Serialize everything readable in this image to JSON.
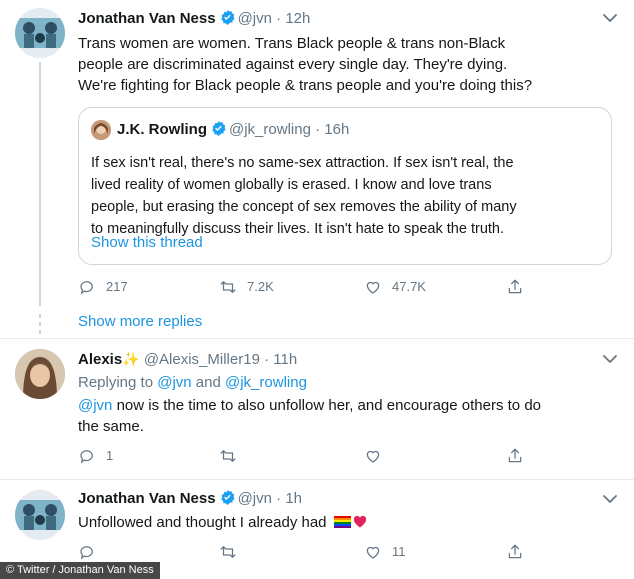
{
  "tweets": [
    {
      "name": "Jonathan Van Ness",
      "handle": "@jvn",
      "separator": "·",
      "time": "12h",
      "lines": [
        "Trans women are women. Trans Black people & trans non-Black",
        "people are discriminated against every single day. They're dying.",
        "We're fighting for Black people & trans people and you're doing this?"
      ],
      "quote": {
        "name": "J.K. Rowling",
        "handle": "@jk_rowling",
        "separator": "·",
        "time": "16h",
        "lines": [
          "If sex isn't real, there's no same-sex attraction. If sex isn't real, the",
          "lived reality of women globally is erased. I know and love trans",
          "people, but erasing the concept of sex removes the ability of many",
          "to meaningfully discuss their lives. It isn't hate to speak the truth."
        ],
        "show_thread": "Show this thread"
      },
      "actions": {
        "replies": "217",
        "retweets": "7.2K",
        "likes": "47.7K"
      }
    },
    {
      "name": "Alexis",
      "name_emoji": "✨",
      "handle": "@Alexis_Miller19",
      "separator": "·",
      "time": "11h",
      "replying_prefix": "Replying to ",
      "replying_user1": "@jvn",
      "replying_and": " and ",
      "replying_user2": "@jk_rowling",
      "mention": "@jvn",
      "line1_rest": " now is the time to also unfollow her, and encourage others to do",
      "line2": "the same.",
      "actions": {
        "replies": "1",
        "retweets": "",
        "likes": ""
      }
    },
    {
      "name": "Jonathan Van Ness",
      "handle": "@jvn",
      "separator": "·",
      "time": "1h",
      "text": "Unfollowed and thought I already had",
      "actions": {
        "replies": "",
        "retweets": "",
        "likes": "11"
      }
    }
  ],
  "show_more_replies": "Show more replies",
  "caption": "© Twitter / Jonathan Van Ness",
  "colors": {
    "link": "#1b95e0",
    "text": "#14171a",
    "secondary": "#657786",
    "border": "#ccd6dd",
    "verified": "#1da1f2"
  },
  "icons": [
    "chevron-down-icon",
    "verified-badge-icon",
    "reply-icon",
    "retweet-icon",
    "like-icon",
    "share-icon",
    "rainbow-flag-emoji",
    "heart-emoji"
  ]
}
